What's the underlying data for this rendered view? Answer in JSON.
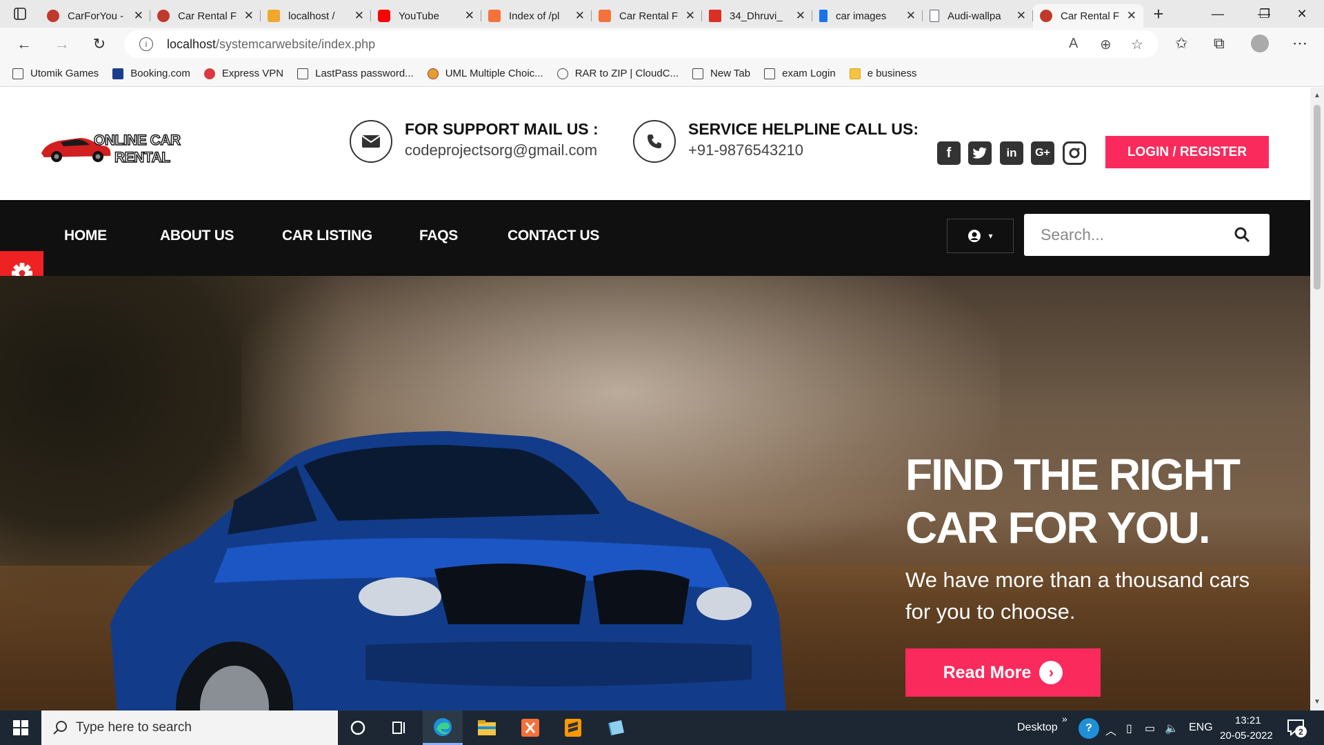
{
  "browser": {
    "tabs": [
      {
        "title": "CarForYou - ",
        "color": "#c0392b"
      },
      {
        "title": "Car Rental F",
        "color": "#c0392b"
      },
      {
        "title": "localhost / ",
        "color": "#f1a72b"
      },
      {
        "title": "YouTube",
        "color": "#ff0000"
      },
      {
        "title": "Index of /pl",
        "color": "#f4713a"
      },
      {
        "title": "Car Rental F",
        "color": "#f4713a"
      },
      {
        "title": "34_Dhruvi_",
        "color": "#d93025"
      },
      {
        "title": "car images",
        "color": "#1a73e8"
      },
      {
        "title": "Audi-wallpa",
        "color": "#5f6368"
      },
      {
        "title": "Car Rental F",
        "color": "#c0392b"
      }
    ],
    "url_host": "localhost",
    "url_path": "/systemcarwebsite/index.php",
    "bookmarks": [
      "Utomik Games",
      "Booking.com",
      "Express VPN",
      "LastPass password...",
      "UML Multiple Choic...",
      "RAR to ZIP | CloudC...",
      "New Tab",
      "exam Login",
      "e business"
    ]
  },
  "header": {
    "logo_line1": "ONLINE CAR",
    "logo_line2": "RENTAL",
    "support_title": "FOR SUPPORT MAIL US :",
    "support_email": "codeprojectsorg@gmail.com",
    "helpline_title": "SERVICE HELPLINE CALL US:",
    "helpline_phone": "+91-9876543210",
    "social_icons": [
      "facebook-icon",
      "twitter-icon",
      "linkedin-icon",
      "google-plus-icon",
      "instagram-icon"
    ],
    "login_label": "LOGIN / REGISTER"
  },
  "nav": {
    "items": [
      "HOME",
      "ABOUT US",
      "CAR LISTING",
      "FAQS",
      "CONTACT US"
    ],
    "search_placeholder": "Search..."
  },
  "hero": {
    "title_line1": "FIND THE RIGHT",
    "title_line2": "CAR FOR YOU.",
    "subtitle_line1": "We have more than a thousand cars",
    "subtitle_line2": "for you to choose.",
    "button_label": "Read More"
  },
  "taskbar": {
    "search_placeholder": "Type here to search",
    "desktop_label": "Desktop",
    "lang": "ENG",
    "time": "13:21",
    "date": "20-05-2022",
    "notification_count": "2"
  },
  "colors": {
    "accent": "#fa2a5c",
    "nav_bg": "#101010",
    "gear_bg": "#e22222"
  }
}
